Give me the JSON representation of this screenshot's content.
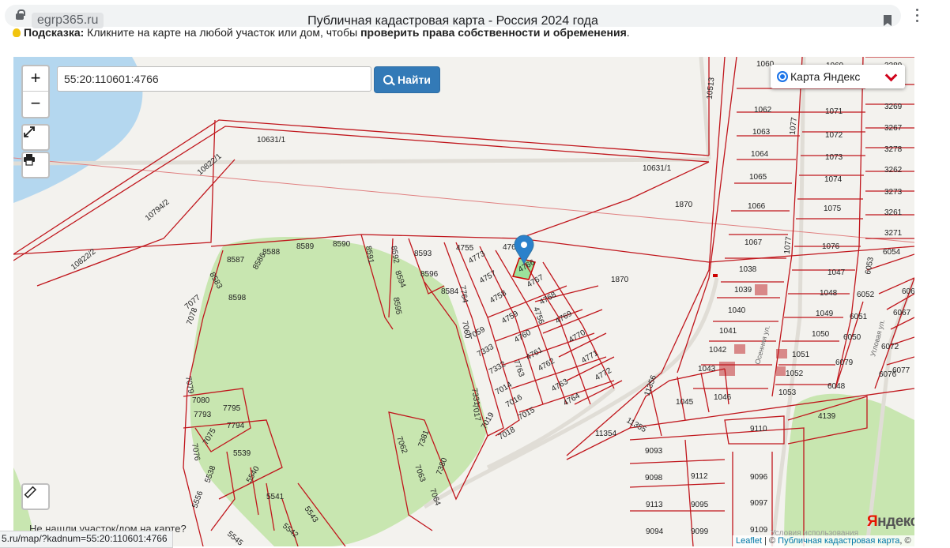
{
  "browser": {
    "domain": "egrp365.ru",
    "title": "Публичная кадастровая карта - Россия 2024 года"
  },
  "hint": {
    "label": "Подсказка:",
    "text": " Кликните на карте на любой участок или дом, чтобы ",
    "bold": "проверить права собственности и обременения",
    "end": "."
  },
  "map": {
    "zoom_in": "+",
    "zoom_out": "−",
    "search_value": "55:20:110601:4766",
    "search_button": "Найти",
    "layer": "Карта Яндекс",
    "not_found": "Не нашли участок/дом на карте?",
    "attribution": {
      "leaflet": "Leaflet",
      "sep": " | © ",
      "pkk": "Публичная кадастровая карта",
      "end": ", ©"
    },
    "terms": "Условия использования",
    "yandex_ya": "Я",
    "yandex_rest": "ндекс",
    "streets": [
      "Осенняя ул.",
      "Угловая ул."
    ],
    "selected_parcel": "4766",
    "parcels": [
      "1060",
      "1062",
      "1063",
      "1064",
      "1065",
      "1066",
      "1067",
      "1038",
      "1039",
      "1040",
      "1041",
      "1042",
      "1043",
      "1046",
      "1045",
      "1047",
      "1048",
      "1049",
      "1050",
      "1051",
      "1052",
      "1053",
      "1069",
      "1071",
      "1072",
      "1073",
      "1074",
      "1075",
      "1076",
      "3280",
      "3269",
      "3267",
      "3278",
      "3262",
      "3273",
      "3261",
      "3271",
      "6054",
      "6053",
      "6052",
      "6051",
      "6050",
      "6079",
      "6048",
      "6072",
      "6076",
      "6077",
      "6067",
      "606",
      "1870",
      "1870",
      "10513",
      "1077",
      "1077",
      "10631/1",
      "10631/1",
      "10822/1",
      "10794/2",
      "10822/2",
      "8587",
      "8588",
      "8589",
      "8590",
      "8591",
      "8592",
      "8593",
      "8594",
      "8595",
      "8596",
      "8583",
      "8586",
      "8598",
      "8584",
      "7077",
      "7078",
      "7079",
      "7080",
      "7793",
      "7795",
      "7794",
      "7075",
      "7076",
      "5539",
      "5538",
      "5540",
      "5541",
      "5543",
      "5542",
      "5545",
      "5556",
      "4755",
      "4773",
      "4757",
      "4758",
      "4759",
      "4760",
      "4761",
      "4762",
      "4763",
      "4764",
      "4765",
      "4767",
      "4768",
      "4769",
      "4770",
      "4771",
      "4772",
      "4756",
      "7764",
      "7060",
      "7059",
      "7333",
      "7332",
      "7331",
      "7763",
      "7014",
      "7016",
      "7015",
      "7017",
      "7019",
      "7018",
      "7062",
      "7381",
      "7063",
      "7380",
      "7064",
      "11356",
      "11355",
      "11354",
      "9110",
      "4139",
      "9093",
      "9098",
      "9112",
      "9096",
      "9113",
      "9095",
      "9097",
      "9094",
      "9099",
      "9109"
    ]
  },
  "status_url": "5.ru/map/?kadnum=55:20:110601:4766"
}
